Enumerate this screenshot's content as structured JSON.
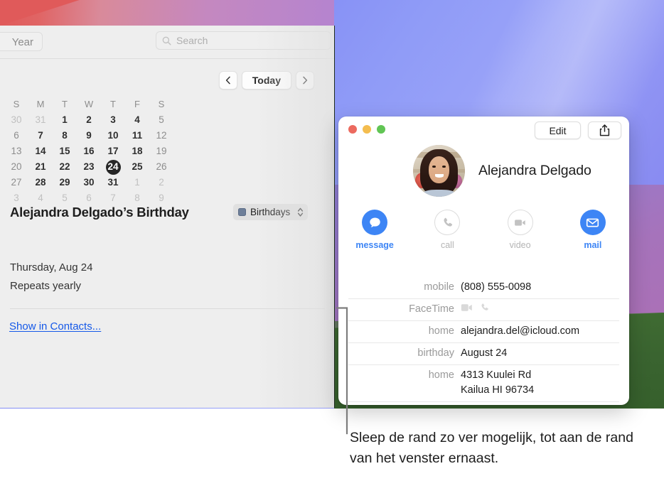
{
  "desktop": {
    "wallpaper_colors": {
      "blue": "#7e86f3",
      "purple": "#a673bb",
      "green": "#3a6430",
      "red": "#e05a5a"
    }
  },
  "calendar_window": {
    "toolbar": {
      "year_button_label": "Year",
      "search_placeholder": "Search",
      "search_icon": "search-icon"
    },
    "navigation": {
      "previous_label": "‹",
      "today_label": "Today",
      "next_label": "›",
      "previous_icon": "chevron-left-icon",
      "next_icon": "chevron-right-icon"
    },
    "month_grid": {
      "day_headers": [
        "S",
        "M",
        "T",
        "W",
        "T",
        "F",
        "S"
      ],
      "weeks": [
        [
          {
            "n": "30",
            "type": "other"
          },
          {
            "n": "31",
            "type": "other"
          },
          {
            "n": "1",
            "type": "weekday"
          },
          {
            "n": "2",
            "type": "weekday"
          },
          {
            "n": "3",
            "type": "weekday"
          },
          {
            "n": "4",
            "type": "weekday"
          },
          {
            "n": "5",
            "type": "weekend"
          }
        ],
        [
          {
            "n": "6",
            "type": "weekend"
          },
          {
            "n": "7",
            "type": "weekday"
          },
          {
            "n": "8",
            "type": "weekday"
          },
          {
            "n": "9",
            "type": "weekday"
          },
          {
            "n": "10",
            "type": "weekday"
          },
          {
            "n": "11",
            "type": "weekday"
          },
          {
            "n": "12",
            "type": "weekend"
          }
        ],
        [
          {
            "n": "13",
            "type": "weekend"
          },
          {
            "n": "14",
            "type": "weekday"
          },
          {
            "n": "15",
            "type": "weekday"
          },
          {
            "n": "16",
            "type": "weekday"
          },
          {
            "n": "17",
            "type": "weekday"
          },
          {
            "n": "18",
            "type": "weekday"
          },
          {
            "n": "19",
            "type": "weekend"
          }
        ],
        [
          {
            "n": "20",
            "type": "weekend"
          },
          {
            "n": "21",
            "type": "weekday"
          },
          {
            "n": "22",
            "type": "weekday"
          },
          {
            "n": "23",
            "type": "weekday"
          },
          {
            "n": "24",
            "type": "today"
          },
          {
            "n": "25",
            "type": "weekday"
          },
          {
            "n": "26",
            "type": "weekend"
          }
        ],
        [
          {
            "n": "27",
            "type": "weekend"
          },
          {
            "n": "28",
            "type": "weekday"
          },
          {
            "n": "29",
            "type": "weekday"
          },
          {
            "n": "30",
            "type": "weekday"
          },
          {
            "n": "31",
            "type": "weekday"
          },
          {
            "n": "1",
            "type": "other"
          },
          {
            "n": "2",
            "type": "other"
          }
        ],
        [
          {
            "n": "3",
            "type": "other"
          },
          {
            "n": "4",
            "type": "other"
          },
          {
            "n": "5",
            "type": "other"
          },
          {
            "n": "6",
            "type": "other"
          },
          {
            "n": "7",
            "type": "other"
          },
          {
            "n": "8",
            "type": "other"
          },
          {
            "n": "9",
            "type": "other"
          }
        ]
      ],
      "selected_day": "24"
    },
    "event": {
      "title": "Alejandra Delgado’s Birthday",
      "calendar_name": "Birthdays",
      "calendar_color": "#6e7f99",
      "date_line": "Thursday, Aug 24",
      "repeat_line": "Repeats yearly",
      "link_label": "Show in Contacts..."
    }
  },
  "contacts_card": {
    "window_controls": {
      "close": "close-button",
      "minimize": "minimize-button",
      "zoom": "zoom-button",
      "close_color": "#ec6a5f",
      "minimize_color": "#f4bd4f",
      "zoom_color": "#61c554"
    },
    "edit_button_label": "Edit",
    "share_icon": "share-icon",
    "contact_name": "Alejandra Delgado",
    "avatar": "contact-avatar",
    "actions": [
      {
        "label": "message",
        "icon": "message-bubble-icon",
        "enabled": true
      },
      {
        "label": "call",
        "icon": "phone-icon",
        "enabled": false
      },
      {
        "label": "video",
        "icon": "video-camera-icon",
        "enabled": false
      },
      {
        "label": "mail",
        "icon": "envelope-icon",
        "enabled": true
      }
    ],
    "fields": [
      {
        "label": "mobile",
        "value": "(808) 555-0098",
        "kind": "text"
      },
      {
        "label": "FaceTime",
        "value": "",
        "kind": "icons",
        "icons": [
          "video-camera-icon",
          "phone-icon"
        ]
      },
      {
        "label": "home",
        "value": "alejandra.del@icloud.com",
        "kind": "text"
      },
      {
        "label": "birthday",
        "value": "August 24",
        "kind": "text"
      },
      {
        "label": "home",
        "value": "",
        "kind": "address",
        "address_lines": [
          "4313 Kuulei Rd",
          "Kailua HI 96734"
        ]
      }
    ]
  },
  "callout": {
    "caption": "Sleep de rand zo ver mogelijk, tot aan de rand van het venster ernaast."
  }
}
